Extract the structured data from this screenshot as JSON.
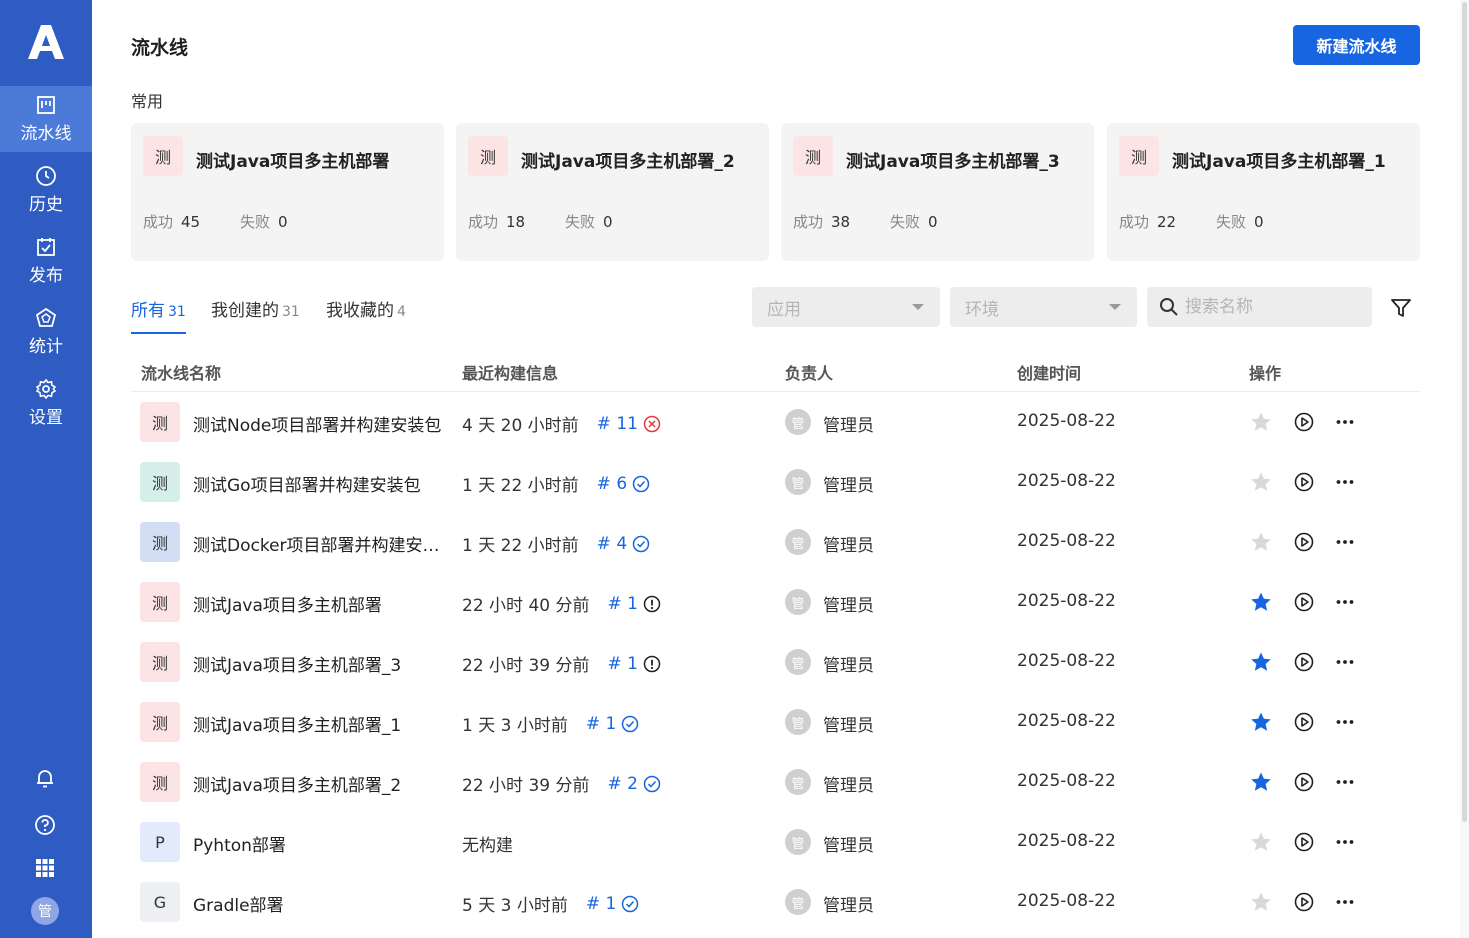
{
  "header": {
    "title": "流水线",
    "new_button": "新建流水线"
  },
  "sidebar": {
    "logo": "A",
    "items": [
      {
        "label": "流水线",
        "icon": "pipeline-icon",
        "active": true
      },
      {
        "label": "历史",
        "icon": "clock-icon"
      },
      {
        "label": "发布",
        "icon": "calendar-check-icon"
      },
      {
        "label": "统计",
        "icon": "stats-icon"
      },
      {
        "label": "设置",
        "icon": "gear-icon"
      }
    ],
    "user_initial": "管"
  },
  "favorites": {
    "label": "常用",
    "success_label": "成功",
    "fail_label": "失败",
    "cards": [
      {
        "badge": "测",
        "name": "测试Java项目多主机部署",
        "success": "45",
        "fail": "0"
      },
      {
        "badge": "测",
        "name": "测试Java项目多主机部署_2",
        "success": "18",
        "fail": "0"
      },
      {
        "badge": "测",
        "name": "测试Java项目多主机部署_3",
        "success": "38",
        "fail": "0"
      },
      {
        "badge": "测",
        "name": "测试Java项目多主机部署_1",
        "success": "22",
        "fail": "0"
      }
    ]
  },
  "tabs": [
    {
      "label": "所有",
      "count": "31",
      "active": true
    },
    {
      "label": "我创建的",
      "count": "31"
    },
    {
      "label": "我收藏的",
      "count": "4"
    }
  ],
  "filters": {
    "app_placeholder": "应用",
    "env_placeholder": "环境",
    "search_placeholder": "搜索名称"
  },
  "table": {
    "columns": [
      "流水线名称",
      "最近构建信息",
      "负责人",
      "创建时间",
      "操作"
    ],
    "rows": [
      {
        "badge": "测",
        "badge_color": "#fde4e4",
        "name": "测试Node项目部署并构建安装包",
        "time": "4 天 20 小时前",
        "build": "# 11",
        "status": "failed",
        "owner_initial": "管",
        "owner": "管理员",
        "date": "2025-08-22",
        "starred": false
      },
      {
        "badge": "测",
        "badge_color": "#d6efe9",
        "name": "测试Go项目部署并构建安装包",
        "time": "1 天 22 小时前",
        "build": "# 6",
        "status": "success",
        "owner_initial": "管",
        "owner": "管理员",
        "date": "2025-08-22",
        "starred": false
      },
      {
        "badge": "测",
        "badge_color": "#d3ddf4",
        "name": "测试Docker项目部署并构建安装包",
        "time": "1 天 22 小时前",
        "build": "# 4",
        "status": "success",
        "owner_initial": "管",
        "owner": "管理员",
        "date": "2025-08-22",
        "starred": false
      },
      {
        "badge": "测",
        "badge_color": "#fde4e4",
        "name": "测试Java项目多主机部署",
        "time": "22 小时 40 分前",
        "build": "# 1",
        "status": "warning",
        "owner_initial": "管",
        "owner": "管理员",
        "date": "2025-08-22",
        "starred": true
      },
      {
        "badge": "测",
        "badge_color": "#fde4e4",
        "name": "测试Java项目多主机部署_3",
        "time": "22 小时 39 分前",
        "build": "# 1",
        "status": "warning",
        "owner_initial": "管",
        "owner": "管理员",
        "date": "2025-08-22",
        "starred": true
      },
      {
        "badge": "测",
        "badge_color": "#fde4e4",
        "name": "测试Java项目多主机部署_1",
        "time": "1 天 3 小时前",
        "build": "# 1",
        "status": "success",
        "owner_initial": "管",
        "owner": "管理员",
        "date": "2025-08-22",
        "starred": true
      },
      {
        "badge": "测",
        "badge_color": "#fde4e4",
        "name": "测试Java项目多主机部署_2",
        "time": "22 小时 39 分前",
        "build": "# 2",
        "status": "success",
        "owner_initial": "管",
        "owner": "管理员",
        "date": "2025-08-22",
        "starred": true
      },
      {
        "badge": "P",
        "badge_color": "#e3eafb",
        "name": "Pyhton部署",
        "time": "无构建",
        "build": "",
        "status": "none",
        "owner_initial": "管",
        "owner": "管理员",
        "date": "2025-08-22",
        "starred": false
      },
      {
        "badge": "G",
        "badge_color": "#eeeff3",
        "name": "Gradle部署",
        "time": "5 天 3 小时前",
        "build": "# 1",
        "status": "success",
        "owner_initial": "管",
        "owner": "管理员",
        "date": "2025-08-22",
        "starred": false
      }
    ]
  },
  "colors": {
    "sidebar": "#2f5cc2",
    "accent": "#1765e0",
    "failed": "#e5383b",
    "star_on": "#1765e0",
    "star_off": "#d9d9d9"
  }
}
